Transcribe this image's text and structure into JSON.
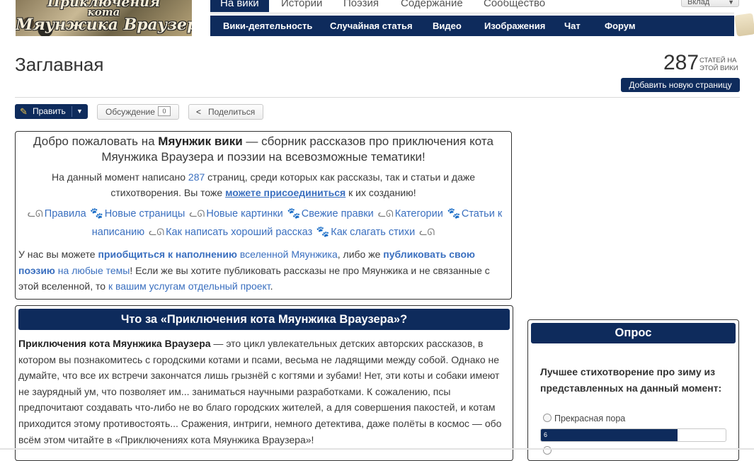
{
  "logo": {
    "lines": [
      "Приключения",
      "кота",
      "Мяунжика Враузера"
    ]
  },
  "topnav": {
    "items": [
      "На вики",
      "Истории",
      "Поэзия",
      "Содержание",
      "Сообщество"
    ],
    "inbox_label": "Вклад"
  },
  "subnav": {
    "items": [
      "Вики-деятельность",
      "Случайная статья",
      "Видео",
      "Изображения",
      "Чат",
      "Форум"
    ]
  },
  "page": {
    "title": "Заглавная",
    "article_count": "287",
    "article_count_label": "СТАТЕЙ НА ЭТОЙ ВИКИ",
    "add_page_label": "Добавить новую страницу"
  },
  "toolbar": {
    "edit_label": "Править",
    "discuss_label": "Обсуждение",
    "discuss_count": "0",
    "share_label": "Поделиться"
  },
  "welcome": {
    "heading_pre": "Добро пожаловать на ",
    "heading_bold": "Мяунжик вики",
    "heading_post": " — сборник рассказов про приключения кота",
    "heading_line2": "Мяунжика Враузера и поэзии на всевозможные тематики!",
    "stats_pre": "На данный момент написано ",
    "stats_count": "287",
    "stats_post": " страниц, среди которых как рассказы, так и статьи и даже",
    "stats_line2_pre": "стихотворения. Вы тоже ",
    "stats_join": "можете присоединиться",
    "stats_line2_post": " к их созданию!",
    "links": [
      "Правила",
      "Новые страницы",
      "Новые картинки",
      "Свежие правки",
      "Категории",
      "Статьи к написанию",
      "Как написать хороший рассказ",
      "Как слагать стихи"
    ],
    "para_1": "У нас вы можете ",
    "para_link_1": "приобщиться к наполнению",
    "para_link_2": " вселенной Мяунжика",
    "para_2": ", либо же ",
    "para_link_3": "публиковать свою поэзию",
    "para_link_4": " на любые темы",
    "para_3": "! Если же вы хотите публиковать рассказы не про Мяунжика и не связанные с этой вселенной, то ",
    "para_link_5": "к вашим услугам отдельный проект",
    "para_4": "."
  },
  "about": {
    "heading": "Что за «Приключения кота Мяунжика Враузера»?",
    "bold": "Приключения кота Мяунжика Враузера",
    "text": " — это цикл увлекательных детских авторских рассказов, в котором вы познакомитесь с городскими котами и псами, весьма не ладящими между собой. Однако не думайте, что все их встречи закончатся лишь грызнёй с когтями и зубами! Нет, эти коты и собаки имеют не заурядный ум, что позволяет им... заниматься научными разработками. К сожалению, псы предпочитают создавать что-либо не во благо городских жителей, а для совершения пакостей, и котам приходится этому противостоять... Сражения, интриги, немного детектива, даже полёты в космос — обо всём этом читайте в «Приключениях кота Мяунжика Враузера»!"
  },
  "poll": {
    "heading": "Опрос",
    "question": "Лучшее стихотворение про зиму из представленных на данный момент:",
    "option_1": "Прекрасная пора",
    "option_1_votes": "6",
    "option_1_fraction": 0.74
  },
  "colors": {
    "brand": "#0e2b5c",
    "link": "#3a6fbf"
  },
  "icons": {
    "edit": "pencil-icon",
    "share": "share-icon",
    "cat": "cat-icon",
    "paw": "paw-icon"
  }
}
